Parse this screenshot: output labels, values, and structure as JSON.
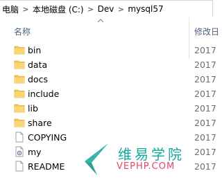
{
  "breadcrumb": {
    "items": [
      "电脑",
      "本地磁盘 (C:)",
      "Dev",
      "mysql57"
    ],
    "separator": ">"
  },
  "columns": {
    "name": "名称",
    "date": "修改日"
  },
  "files": [
    {
      "name": "bin",
      "type": "folder",
      "date": "2017"
    },
    {
      "name": "data",
      "type": "folder",
      "date": "2017"
    },
    {
      "name": "docs",
      "type": "folder",
      "date": "2017"
    },
    {
      "name": "include",
      "type": "folder",
      "date": "2017"
    },
    {
      "name": "lib",
      "type": "folder",
      "date": "2017"
    },
    {
      "name": "share",
      "type": "folder",
      "date": "2017"
    },
    {
      "name": "COPYING",
      "type": "file",
      "date": "2017"
    },
    {
      "name": "my",
      "type": "config-file",
      "date": "2017"
    },
    {
      "name": "README",
      "type": "file",
      "date": "2017"
    }
  ],
  "watermark": {
    "chinese": "维易学院",
    "english": "VEPHP.COM"
  },
  "colors": {
    "folder": "#f4c85a",
    "folder_dark": "#dcaa37",
    "header_text": "#4c607a",
    "watermark_green": "#14a89c",
    "watermark_red": "#e24a6a"
  }
}
